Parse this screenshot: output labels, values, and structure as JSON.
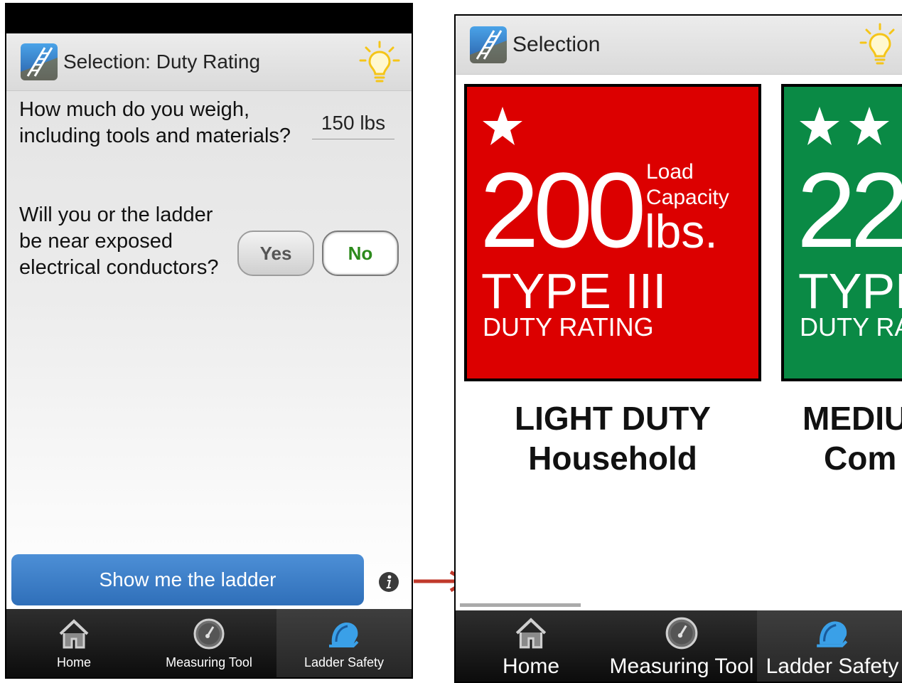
{
  "left_screen": {
    "app_title": "Selection: Duty Rating",
    "weight_question": "How much do you weigh, including tools and materials?",
    "weight_value": "150 lbs",
    "electric_question": "Will you or the ladder be near exposed electrical conductors?",
    "yes_label": "Yes",
    "no_label": "No",
    "selected_option": "No",
    "show_button_label": "Show me the ladder",
    "tabs": [
      {
        "label": "Home",
        "icon": "home-icon"
      },
      {
        "label": "Measuring Tool",
        "icon": "gauge-icon"
      },
      {
        "label": "Ladder Safety",
        "icon": "hard-hat-icon",
        "active": true
      }
    ]
  },
  "right_screen": {
    "app_title": "Selection",
    "cards": [
      {
        "stars": 1,
        "capacity_number": "200",
        "load_line1": "Load",
        "load_line2": "Capacity",
        "unit": "lbs.",
        "type": "TYPE III",
        "duty_rating": "DUTY RATING",
        "caption_line1": "LIGHT DUTY",
        "caption_line2": "Household",
        "color": "#dc0000"
      },
      {
        "stars": 2,
        "capacity_number": "22",
        "type": "TYPE",
        "duty_rating": "DUTY RAT",
        "caption_line1": "MEDIU",
        "caption_line2": "Com",
        "color": "#0a8a45"
      }
    ],
    "tabs": [
      {
        "label": "Home",
        "icon": "home-icon"
      },
      {
        "label": "Measuring Tool",
        "icon": "gauge-icon"
      },
      {
        "label": "Ladder Safety",
        "icon": "hard-hat-icon",
        "active": true
      }
    ]
  },
  "colors": {
    "accent_blue": "#2f6fb9",
    "selected_green": "#2c8a1c",
    "bulb_yellow": "#f5c518",
    "arrow_red": "#c0392b"
  }
}
